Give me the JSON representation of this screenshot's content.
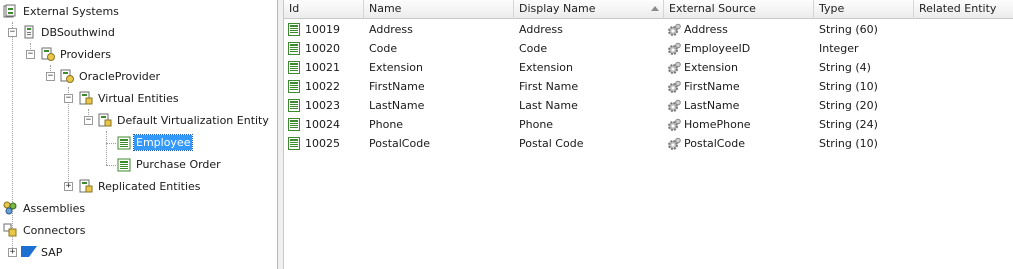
{
  "tree": {
    "root_label": "External Systems",
    "system_label": "DBSouthwind",
    "providers_label": "Providers",
    "provider_label": "OracleProvider",
    "virtual_label": "Virtual Entities",
    "default_virt_label": "Default Virtualization Entity",
    "employee_label": "Employee",
    "purchase_order_label": "Purchase Order",
    "replicated_label": "Replicated Entities",
    "assemblies_label": "Assemblies",
    "connectors_label": "Connectors",
    "sap_label": "SAP",
    "expand_symbol": "+",
    "collapse_symbol": "−"
  },
  "grid": {
    "columns": [
      "Id",
      "Name",
      "Display Name",
      "External Source",
      "Type",
      "Related Entity"
    ],
    "sorted_column": "Display Name",
    "rows": [
      {
        "id": "10019",
        "name": "Address",
        "display": "Address",
        "source": "Address",
        "type": "String (60)",
        "related": ""
      },
      {
        "id": "10020",
        "name": "Code",
        "display": "Code",
        "source": "EmployeeID",
        "type": "Integer",
        "related": ""
      },
      {
        "id": "10021",
        "name": "Extension",
        "display": "Extension",
        "source": "Extension",
        "type": "String (4)",
        "related": ""
      },
      {
        "id": "10022",
        "name": "FirstName",
        "display": "First Name",
        "source": "FirstName",
        "type": "String (10)",
        "related": ""
      },
      {
        "id": "10023",
        "name": "LastName",
        "display": "Last Name",
        "source": "LastName",
        "type": "String (20)",
        "related": ""
      },
      {
        "id": "10024",
        "name": "Phone",
        "display": "Phone",
        "source": "HomePhone",
        "type": "String (24)",
        "related": ""
      },
      {
        "id": "10025",
        "name": "PostalCode",
        "display": "Postal Code",
        "source": "PostalCode",
        "type": "String (10)",
        "related": ""
      }
    ]
  },
  "colors": {
    "selection": "#3399ff",
    "entity_green": "#3c8a2e",
    "icon_yellow": "#e8c64a"
  }
}
